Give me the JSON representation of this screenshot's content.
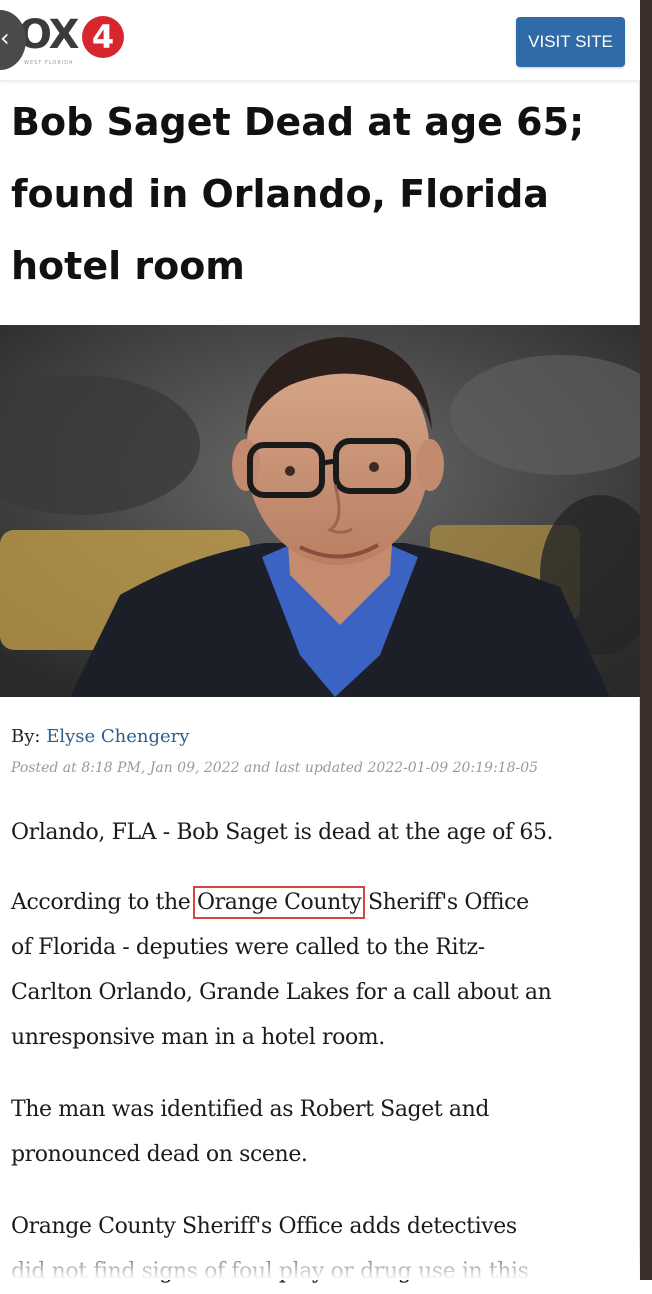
{
  "header": {
    "logo_text": "OX",
    "logo_number": "4",
    "logo_subtext": "WEST FLORIDA",
    "back_glyph": "‹",
    "visit_label": "VISIT SITE"
  },
  "article": {
    "headline_lines": [
      "Bob Saget Dead at age 65;",
      "found in Orlando, Florida",
      "hotel room"
    ],
    "byline_prefix": "By:",
    "author": "Elyse Chengery",
    "posted": "Posted at 8:18 PM, Jan 09, 2022 and last updated 2022-01-09 20:19:18-05",
    "p1": "Orlando, FLA - Bob Saget is dead at the age of 65.",
    "p2_before": "According to the ",
    "p2_highlight": "Orange County",
    "p2_after_line1": "Sheriff's Office",
    "p2_line2": "of Florida - deputies were called to the Ritz-",
    "p2_line3": "Carlton Orlando, Grande Lakes for a call about an",
    "p2_line4": "unresponsive man in a hotel room.",
    "p3_line1": "The man was identified as Robert Saget and",
    "p3_line2": "pronounced dead on scene.",
    "p4_line1": "Orange County Sheriff's Office adds detectives",
    "p4_line2": "did not find signs of foul play or drug use in this"
  },
  "colors": {
    "visit_button": "#2f6ba8",
    "author_link": "#2f5d8c",
    "highlight_box": "#d4473b",
    "logo_red": "#d7262e"
  }
}
